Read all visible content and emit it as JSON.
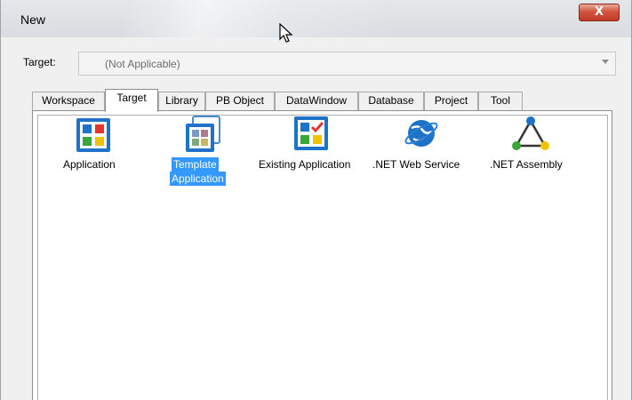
{
  "window": {
    "title": "New",
    "close_glyph": "X"
  },
  "target": {
    "label": "Target:",
    "value": "(Not Applicable)"
  },
  "tabs": [
    {
      "label": "Workspace",
      "active": false
    },
    {
      "label": "Target",
      "active": true
    },
    {
      "label": "Library",
      "active": false
    },
    {
      "label": "PB Object",
      "active": false
    },
    {
      "label": "DataWindow",
      "active": false
    },
    {
      "label": "Database",
      "active": false
    },
    {
      "label": "Project",
      "active": false
    },
    {
      "label": "Tool",
      "active": false
    }
  ],
  "items": [
    {
      "label": "Application",
      "icon": "application-icon"
    },
    {
      "label_line1": "Template",
      "label_line2": "Application",
      "icon": "template-application-icon",
      "selected": true
    },
    {
      "label": "Existing Application",
      "icon": "existing-application-icon"
    },
    {
      "label": ".NET Web Service",
      "icon": "net-web-service-icon"
    },
    {
      "label": ".NET Assembly",
      "icon": "net-assembly-icon"
    }
  ],
  "colors": {
    "selection": "#3399ff",
    "close_button": "#c13b26",
    "icon_blue": "#1e72c8",
    "icon_red": "#e5352b",
    "icon_green": "#3aa53a",
    "icon_yellow": "#f2c200"
  }
}
